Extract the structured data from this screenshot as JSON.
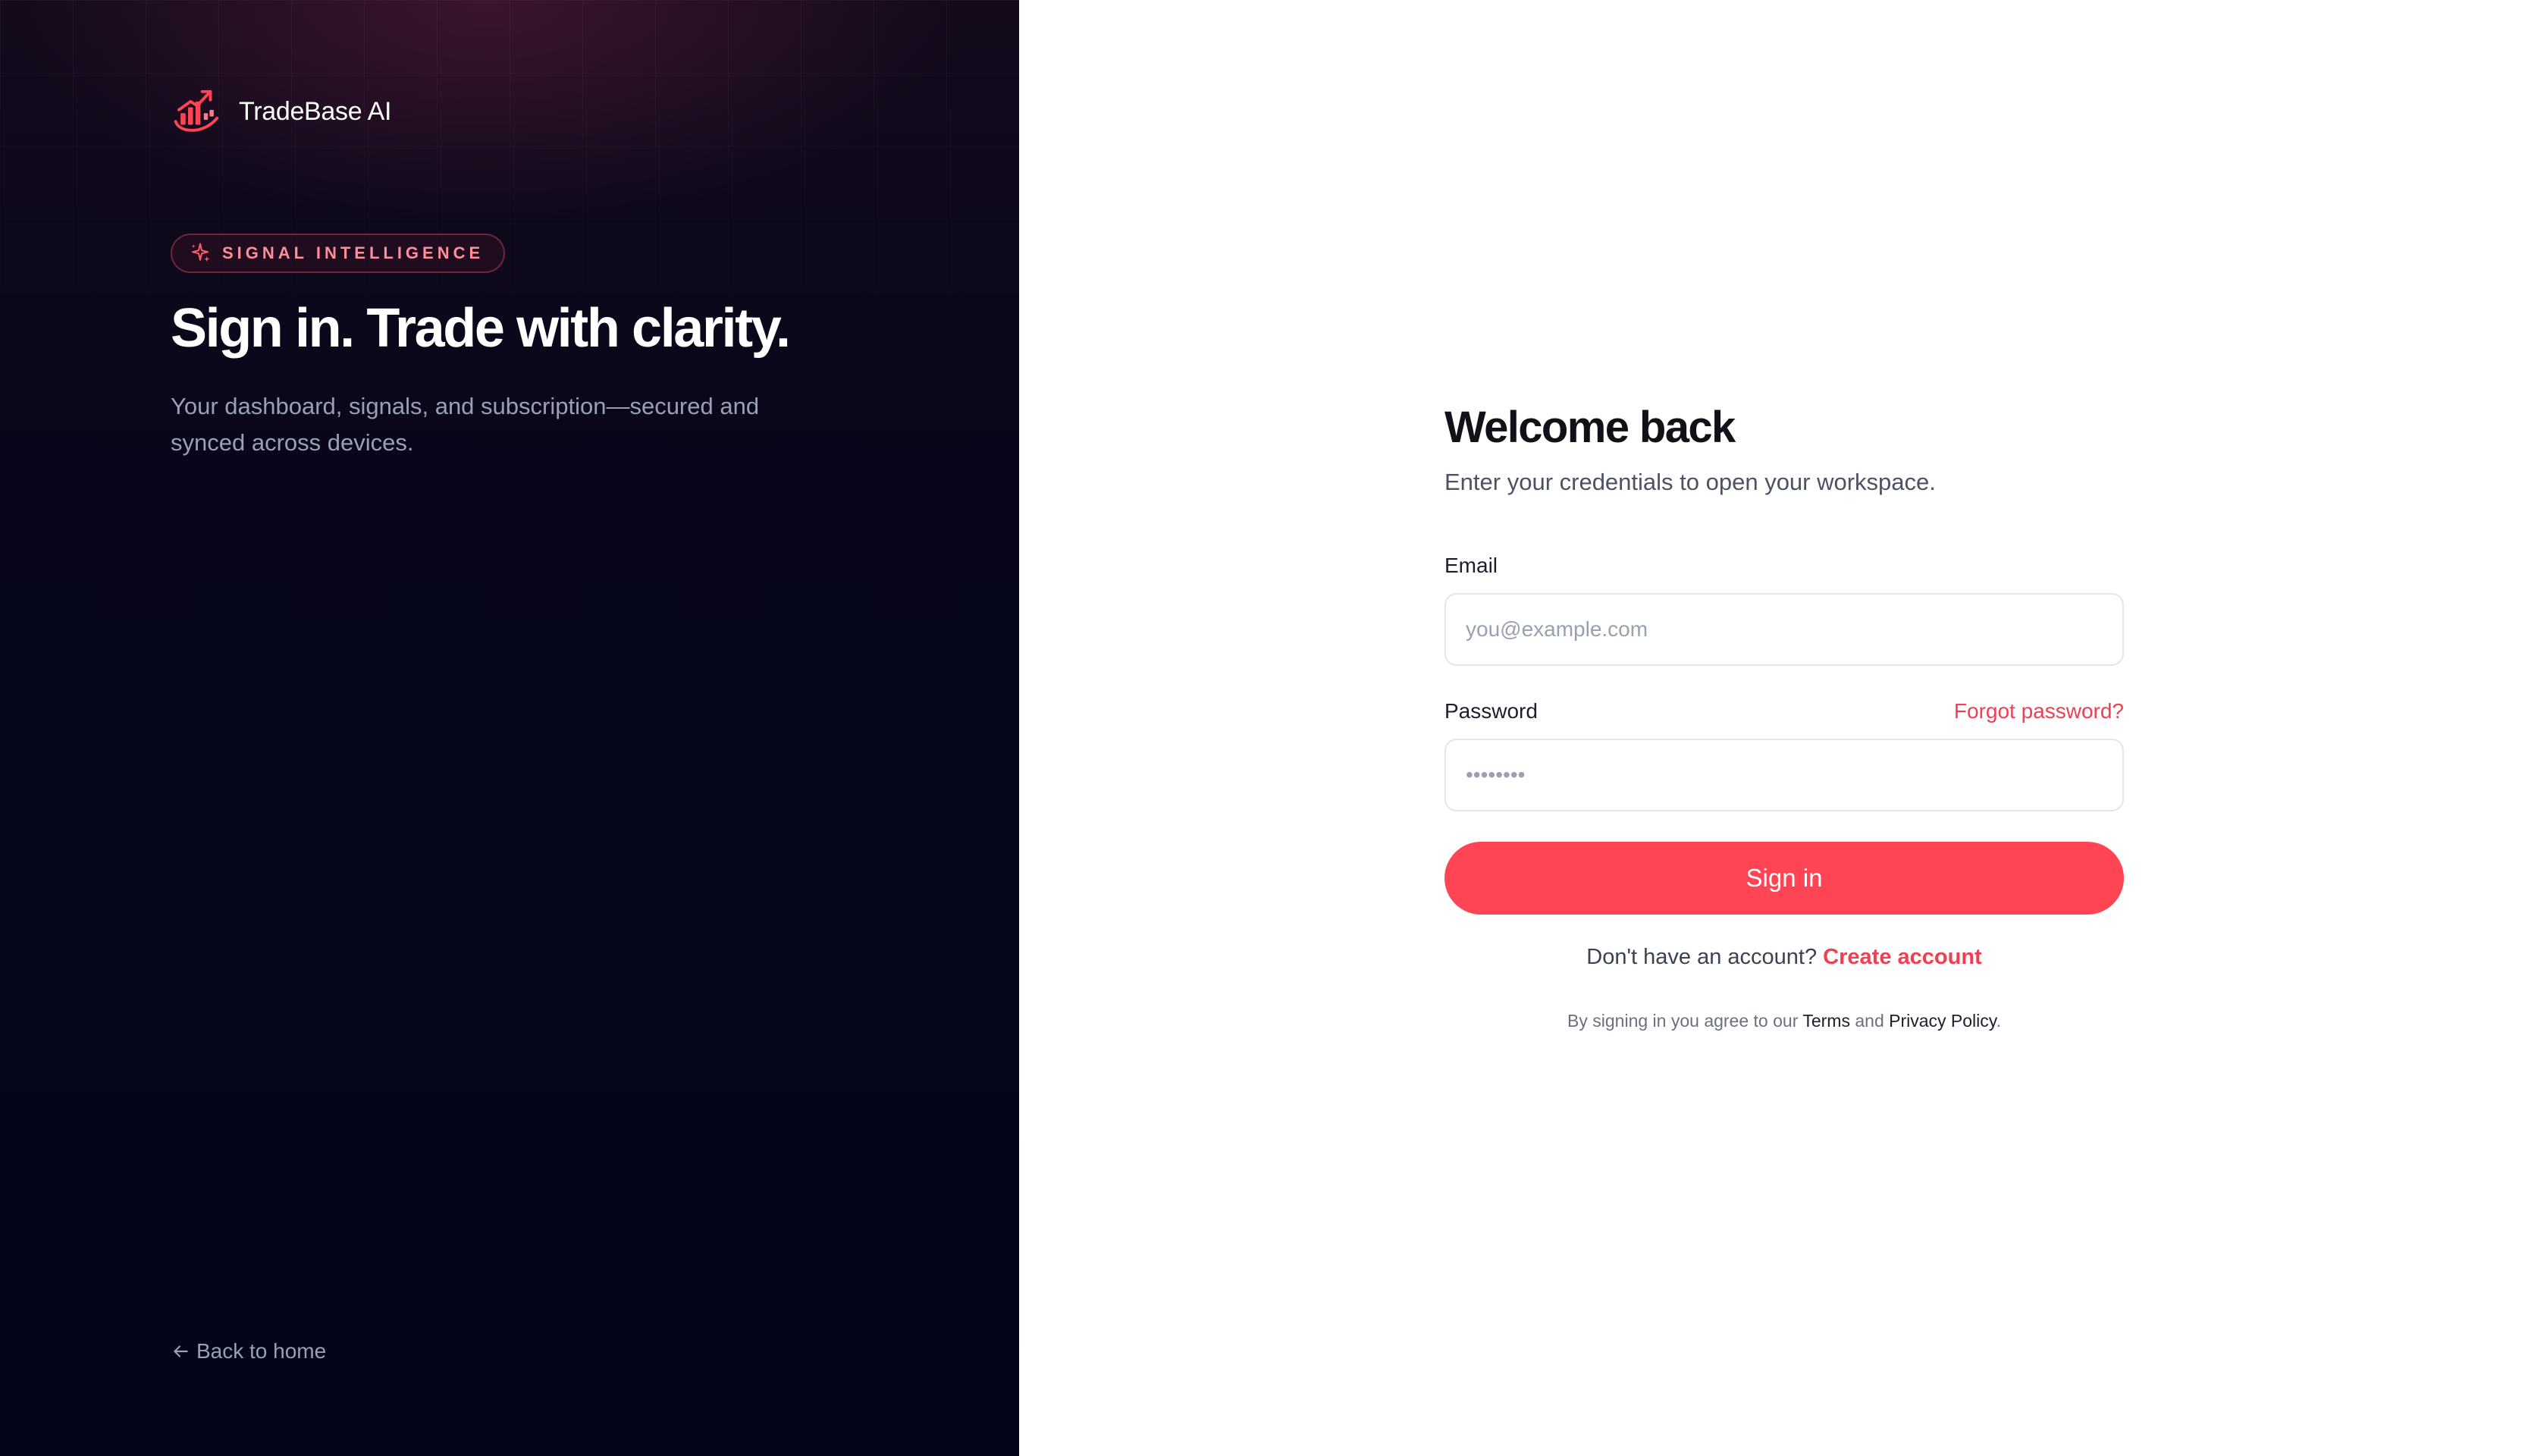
{
  "brand": {
    "name": "TradeBase AI",
    "logo_icon": "chart-rocket-logo-icon",
    "accent_color": "#ff4553"
  },
  "hero": {
    "badge_icon": "sparkle-icon",
    "badge_text": "SIGNAL INTELLIGENCE",
    "headline": "Sign in. Trade with clarity.",
    "subcopy": "Your dashboard, signals, and subscription—secured and synced across devices."
  },
  "nav": {
    "back_icon": "arrow-left-icon",
    "back_label": "Back to home"
  },
  "form": {
    "title": "Welcome back",
    "subtitle": "Enter your credentials to open your workspace.",
    "email": {
      "label": "Email",
      "placeholder": "you@example.com",
      "value": ""
    },
    "password": {
      "label": "Password",
      "placeholder": "••••••••",
      "value": "",
      "forgot_label": "Forgot password?"
    },
    "submit_label": "Sign in",
    "signup_prompt": "Don't have an account?",
    "signup_link": "Create account",
    "legal_prefix": "By signing in you agree to our",
    "terms_link": "Terms",
    "legal_and": "and",
    "privacy_link": "Privacy Policy",
    "legal_suffix": "."
  },
  "colors": {
    "left_bg": "#03051a",
    "link_red": "#ef3f52",
    "button_red": "#ff4553"
  }
}
